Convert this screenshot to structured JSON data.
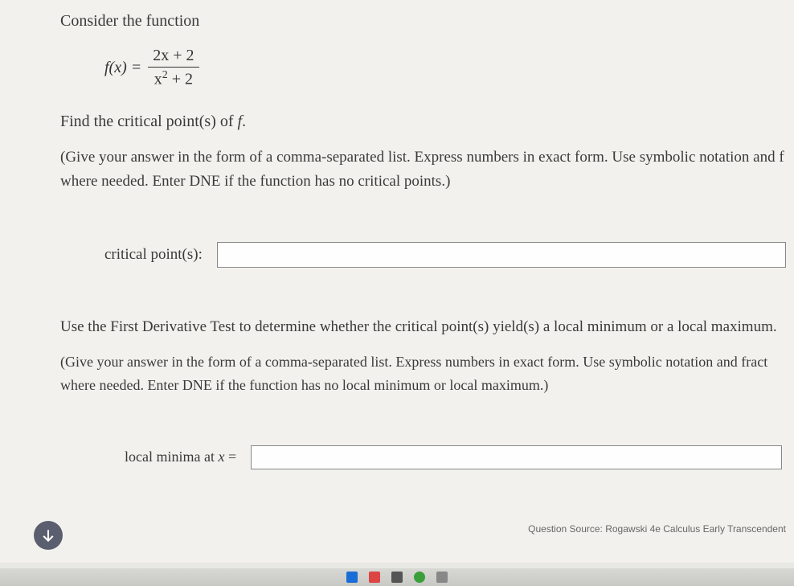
{
  "intro": "Consider the function",
  "formula": {
    "func": "f(x) =",
    "numerator": "2x + 2",
    "denominator_pre": "x",
    "denominator_exp": "2",
    "denominator_post": " + 2"
  },
  "question1": {
    "prefix": "Find the critical point(s) of ",
    "italic": "f",
    "suffix": "."
  },
  "instruction1": "(Give your answer in the form of a comma-separated list. Express numbers in exact form. Use symbolic notation and f where needed. Enter DNE if the function has no critical points.)",
  "answer1": {
    "label": "critical point(s):",
    "value": ""
  },
  "question2": "Use the First Derivative Test to determine whether the critical point(s) yield(s) a local minimum or a local maximum.",
  "instruction2": "(Give your answer in the form of a comma-separated list. Express numbers in exact form. Use symbolic notation and fract where needed. Enter DNE if the function has no local minimum or local maximum.)",
  "answer2": {
    "label_pre": "local minima at ",
    "label_var": "x",
    "label_post": " =",
    "value": ""
  },
  "source": "Question Source: Rogawski 4e Calculus Early Transcendent",
  "taskbar_colors": [
    "#1a6dd6",
    "#d44",
    "#555",
    "#3a9e3a",
    "#888"
  ]
}
